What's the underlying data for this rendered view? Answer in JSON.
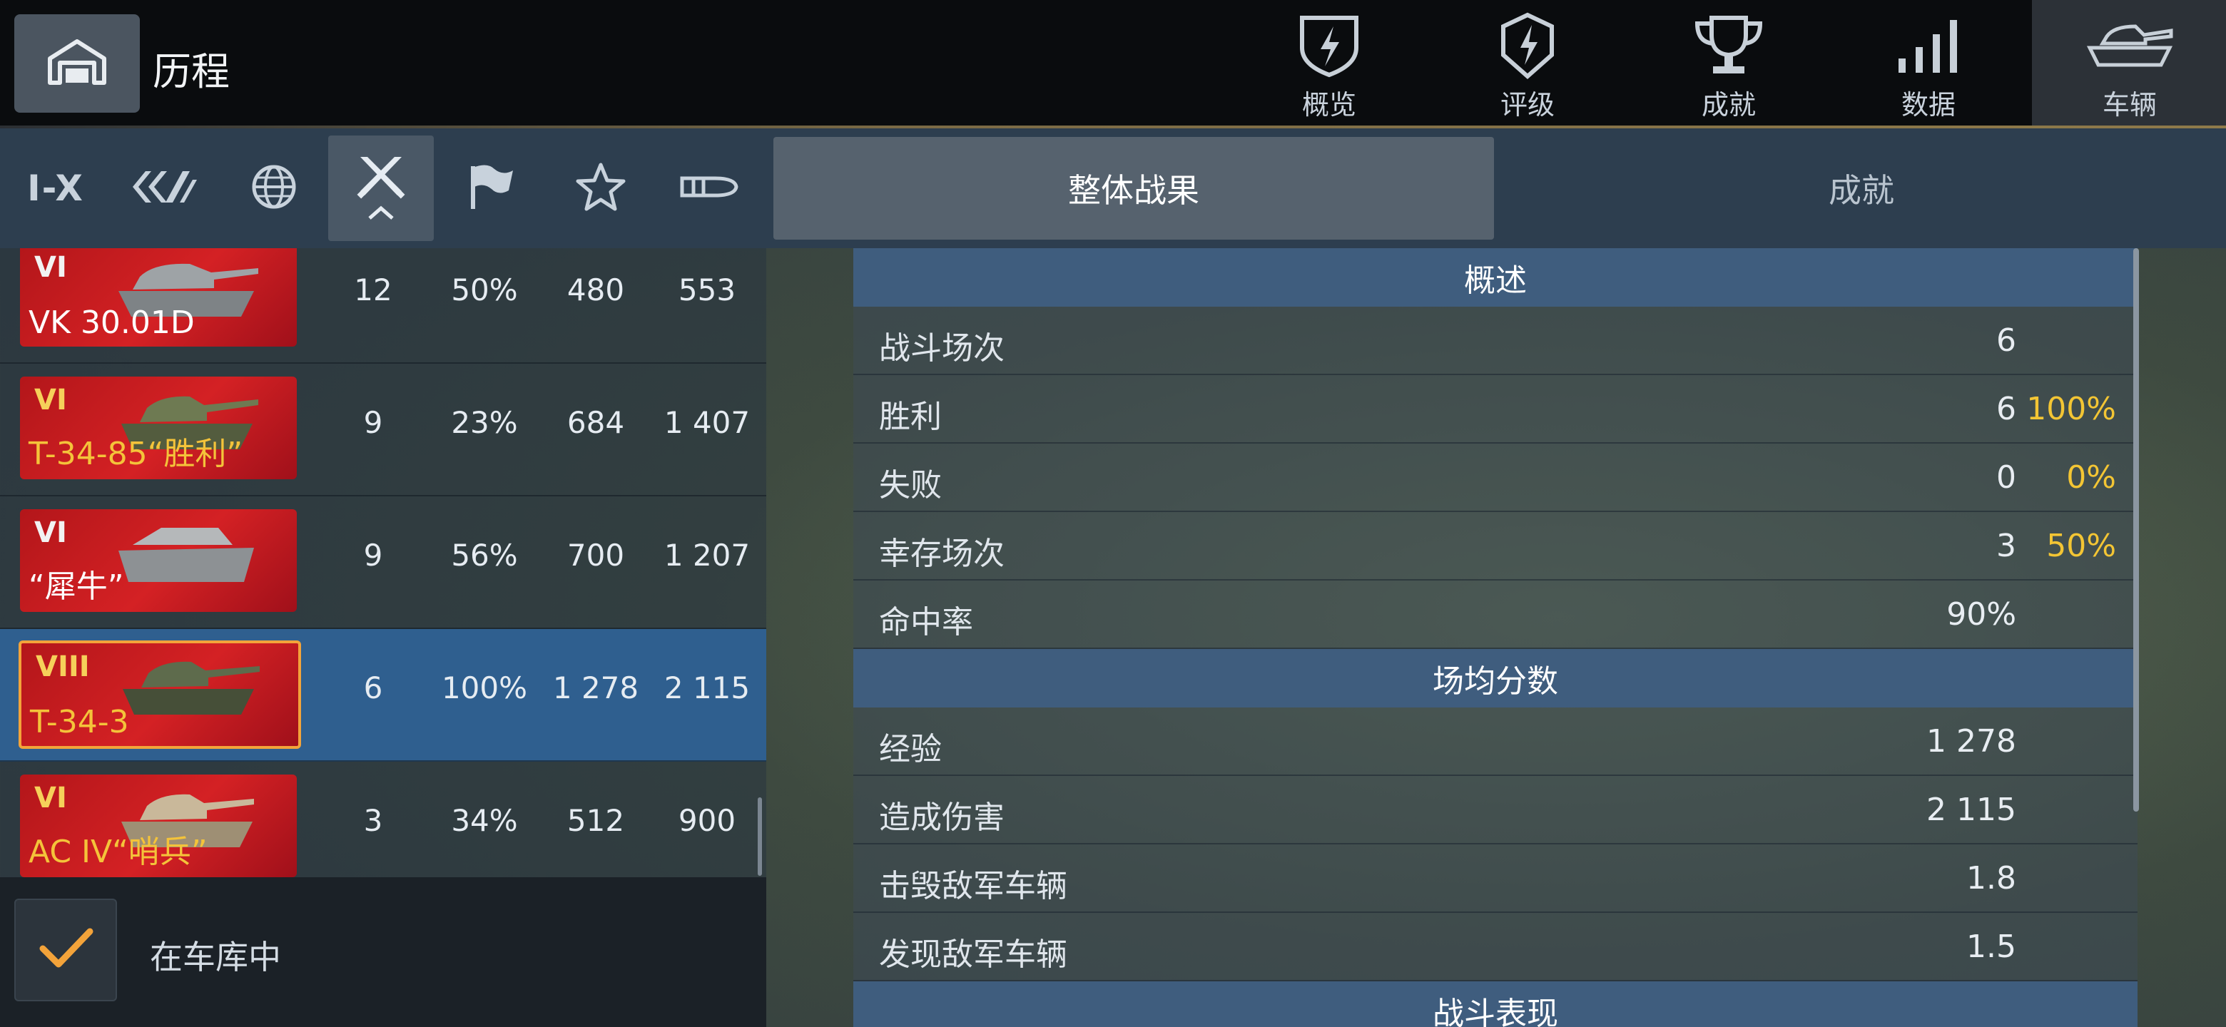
{
  "header": {
    "title": "历程",
    "nav": [
      {
        "label": "概览",
        "icon": "shield-lightning-icon"
      },
      {
        "label": "评级",
        "icon": "rating-badge-icon"
      },
      {
        "label": "成就",
        "icon": "trophy-icon"
      },
      {
        "label": "数据",
        "icon": "bar-chart-icon"
      },
      {
        "label": "车辆",
        "icon": "tank-icon",
        "active": true
      }
    ]
  },
  "filters": {
    "tier_label": "I-X",
    "icons": [
      "tier-filter",
      "vehicle-class-icon",
      "nation-globe-icon",
      "battles-crossed-swords-icon",
      "winrate-flag-icon",
      "xp-star-icon",
      "damage-shell-icon"
    ],
    "active": "battles-crossed-swords-icon"
  },
  "vehicles": [
    {
      "tier": "VI",
      "name": "VK 30.01D",
      "premium": false,
      "battles": "12",
      "winrate": "50%",
      "xp": "480",
      "damage": "553"
    },
    {
      "tier": "VI",
      "name": "T-34-85“胜利”",
      "premium": true,
      "battles": "9",
      "winrate": "23%",
      "xp": "684",
      "damage": "1 407"
    },
    {
      "tier": "VI",
      "name": "“犀牛”",
      "premium": false,
      "battles": "9",
      "winrate": "56%",
      "xp": "700",
      "damage": "1 207"
    },
    {
      "tier": "VIII",
      "name": "T-34-3",
      "premium": true,
      "selected": true,
      "battles": "6",
      "winrate": "100%",
      "xp": "1 278",
      "damage": "2 115"
    },
    {
      "tier": "VI",
      "name": "AC IV“哨兵”",
      "premium": true,
      "battles": "3",
      "winrate": "34%",
      "xp": "512",
      "damage": "900"
    }
  ],
  "garage_filter": {
    "label": "在车库中",
    "checked": true
  },
  "right_tabs": [
    {
      "label": "整体战果",
      "active": true
    },
    {
      "label": "成就",
      "active": false
    }
  ],
  "stats": {
    "overview_title": "概述",
    "overview": [
      {
        "label": "战斗场次",
        "value": "6",
        "pct": ""
      },
      {
        "label": "胜利",
        "value": "6",
        "pct": "100%"
      },
      {
        "label": "失败",
        "value": "0",
        "pct": "0%"
      },
      {
        "label": "幸存场次",
        "value": "3",
        "pct": "50%"
      },
      {
        "label": "命中率",
        "value": "90%",
        "pct": ""
      }
    ],
    "average_title": "场均分数",
    "average": [
      {
        "label": "经验",
        "value": "1 278"
      },
      {
        "label": "造成伤害",
        "value": "2 115"
      },
      {
        "label": "击毁敌军车辆",
        "value": "1.8"
      },
      {
        "label": "发现敌军车辆",
        "value": "1.5"
      }
    ],
    "performance_title": "战斗表现"
  },
  "colors": {
    "accent_gold": "#f3c534",
    "selected_row": "#2f5f8f",
    "card_red": "#c81b1f",
    "section_header": "#3f5d7e",
    "check_orange": "#f3a33a"
  }
}
